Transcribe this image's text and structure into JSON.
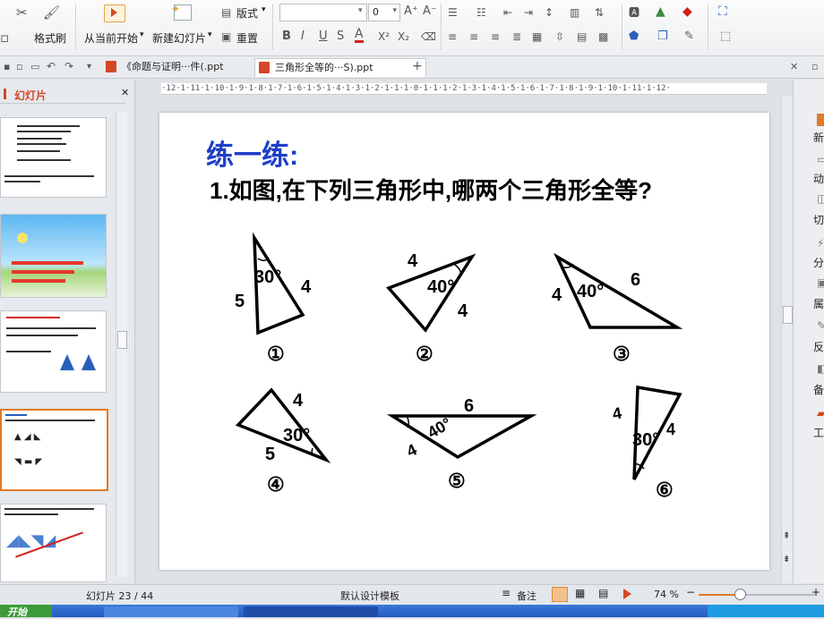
{
  "ribbon": {
    "format_painter": "格式刷",
    "play_from_current": "从当前开始",
    "new_slide": "新建幻灯片",
    "layout": "版式",
    "reset": "重置",
    "font_size": "0"
  },
  "tabs": [
    {
      "label": "《命题与证明···件(.ppt"
    },
    {
      "label": "三角形全等的···S).ppt"
    }
  ],
  "panel": {
    "title": "幻灯片"
  },
  "ruler_text": "·12·1·11·1·10·1·9·1·8·1·7·1·6·1·5·1·4·1·3·1·2·1·1·1·0·1·1·1·2·1·3·1·4·1·5·1·6·1·7·1·8·1·9·1·10·1·11·1·12·",
  "slide": {
    "heading": "练一练:",
    "question": "1.如图,在下列三角形中,哪两个三角形全等?",
    "triangles": [
      {
        "num": "①",
        "labels": [
          "30°",
          "5",
          "4"
        ]
      },
      {
        "num": "②",
        "labels": [
          "4",
          "40°",
          "4"
        ]
      },
      {
        "num": "③",
        "labels": [
          "4",
          "40°",
          "6"
        ]
      },
      {
        "num": "④",
        "labels": [
          "4",
          "30°",
          "5"
        ]
      },
      {
        "num": "⑤",
        "labels": [
          "6",
          "40°",
          "4"
        ]
      },
      {
        "num": "⑥",
        "labels": [
          "4",
          "30°",
          "4"
        ]
      }
    ]
  },
  "right_pane": [
    "新",
    "动",
    "切",
    "分",
    "属",
    "反",
    "备",
    "工"
  ],
  "status": {
    "slide_count": "幻灯片 23 / 44",
    "template": "默认设计模板",
    "notes": "备注",
    "zoom": "74 %"
  },
  "taskbar": {
    "start": "开始"
  },
  "colors": {
    "heading": "#1f3fc9",
    "accent": "#d24726",
    "thumb_selected": "#e07b2a"
  }
}
